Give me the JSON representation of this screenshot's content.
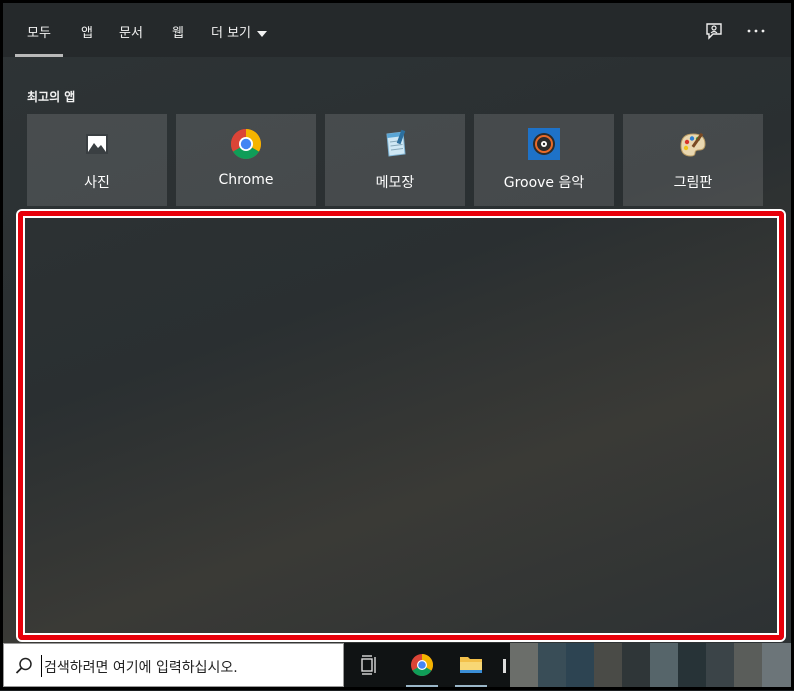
{
  "tabs": [
    "모두",
    "앱",
    "문서",
    "웹",
    "더 보기"
  ],
  "section_title": "최고의 앱",
  "top_apps": [
    {
      "label": "사진",
      "icon": "photos-icon"
    },
    {
      "label": "Chrome",
      "icon": "chrome-icon"
    },
    {
      "label": "메모장",
      "icon": "notepad-icon"
    },
    {
      "label": "Groove 음악",
      "icon": "groove-music-icon"
    },
    {
      "label": "그림판",
      "icon": "paint-icon"
    }
  ],
  "search": {
    "placeholder": "검색하려면 여기에 입력하십시오."
  },
  "colors": {
    "highlight": "#e8000b",
    "taskbar": "#101314",
    "tile": "#4a4f51"
  }
}
